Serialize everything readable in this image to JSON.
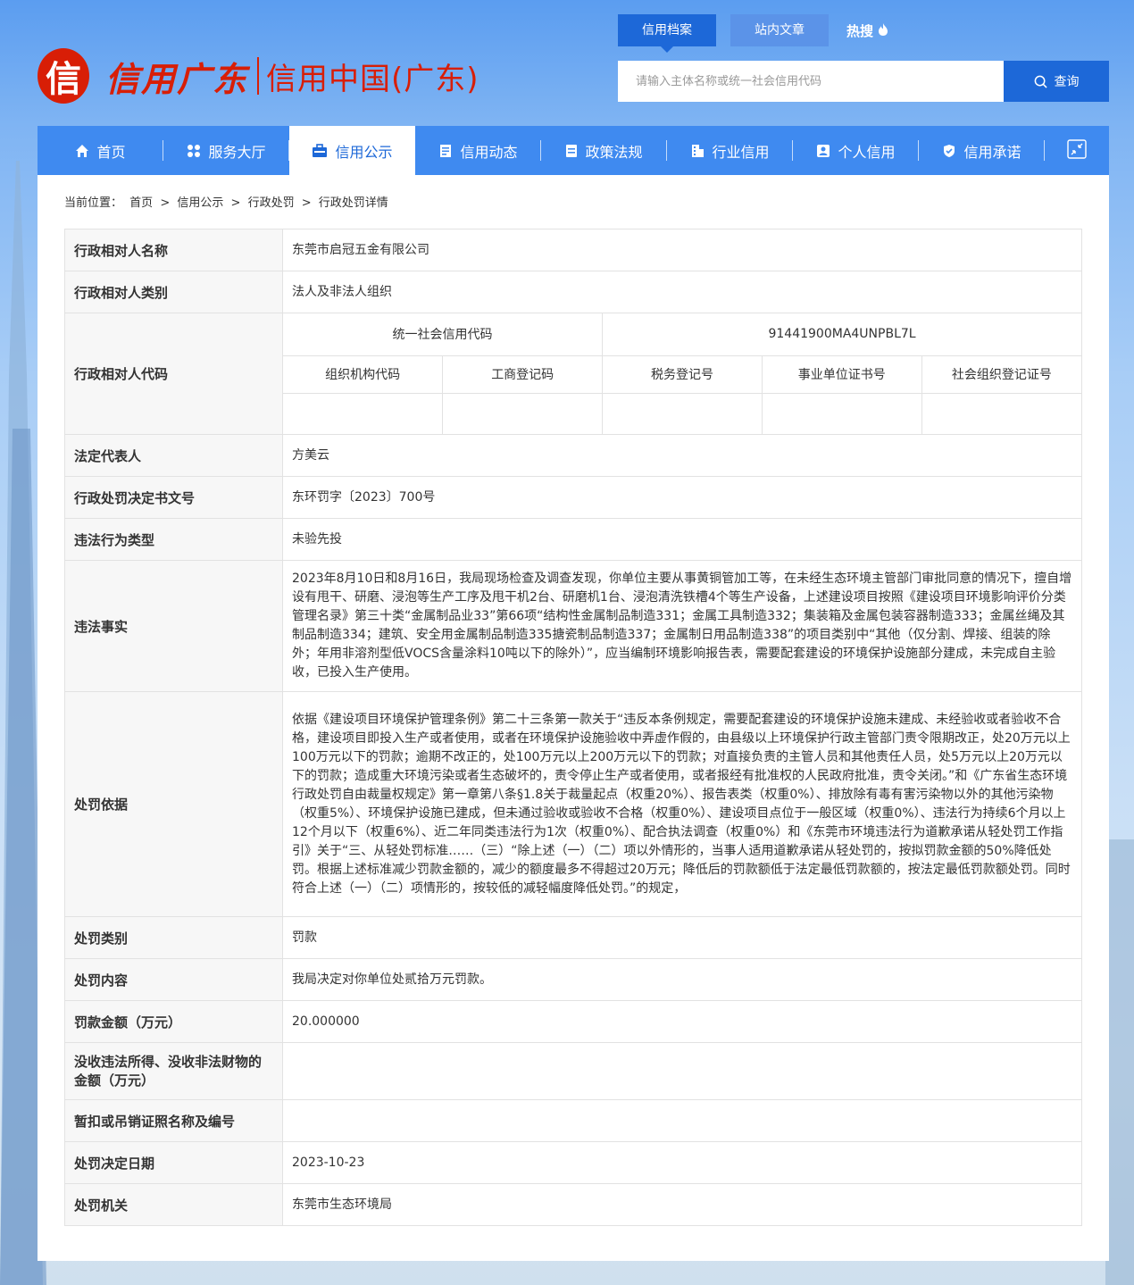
{
  "logo": {
    "mark": "信",
    "brand": "信用广东",
    "sub": "信用中国(广东)"
  },
  "search": {
    "tabs": [
      "信用档案",
      "站内文章"
    ],
    "hot": "热搜",
    "placeholder": "请输入主体名称或统一社会信用代码",
    "button": "查询"
  },
  "nav": {
    "items": [
      "首页",
      "服务大厅",
      "信用公示",
      "信用动态",
      "政策法规",
      "行业信用",
      "个人信用",
      "信用承诺"
    ]
  },
  "breadcrumb": {
    "prefix": "当前位置：",
    "items": [
      "首页",
      "信用公示",
      "行政处罚",
      "行政处罚详情"
    ],
    "sep": ">"
  },
  "detail": {
    "name_label": "行政相对人名称",
    "name": "东莞市启冠五金有限公司",
    "type_label": "行政相对人类别",
    "type": "法人及非法人组织",
    "code_label": "行政相对人代码",
    "credit_code_label": "统一社会信用代码",
    "credit_code": "91441900MA4UNPBL7L",
    "org_code_label": "组织机构代码",
    "biz_reg_label": "工商登记码",
    "tax_reg_label": "税务登记号",
    "inst_cert_label": "事业单位证书号",
    "social_org_label": "社会组织登记证号",
    "org_code": "",
    "biz_reg": "",
    "tax_reg": "",
    "inst_cert": "",
    "social_org": "",
    "legal_rep_label": "法定代表人",
    "legal_rep": "方美云",
    "doc_no_label": "行政处罚决定书文号",
    "doc_no": "东环罚字〔2023〕700号",
    "violation_type_label": "违法行为类型",
    "violation_type": "未验先投",
    "facts_label": "违法事实",
    "facts": "2023年8月10日和8月16日，我局现场检查及调查发现，你单位主要从事黄铜管加工等，在未经生态环境主管部门审批同意的情况下，擅自增设有甩干、研磨、浸泡等生产工序及甩干机2台、研磨机1台、浸泡清洗铁槽4个等生产设备，上述建设项目按照《建设项目环境影响评价分类管理名录》第三十类“金属制品业33”第66项“结构性金属制品制造331；金属工具制造332；集装箱及金属包装容器制造333；金属丝绳及其制品制造334；建筑、安全用金属制品制造335搪瓷制品制造337；金属制日用品制造338”的项目类别中“其他（仅分割、焊接、组装的除外；年用非溶剂型低VOCS含量涂料10吨以下的除外）”，应当编制环境影响报告表，需要配套建设的环境保护设施部分建成，未完成自主验收，已投入生产使用。",
    "basis_label": "处罚依据",
    "basis": "依据《建设项目环境保护管理条例》第二十三条第一款关于“违反本条例规定，需要配套建设的环境保护设施未建成、未经验收或者验收不合格，建设项目即投入生产或者使用，或者在环境保护设施验收中弄虚作假的，由县级以上环境保护行政主管部门责令限期改正，处20万元以上100万元以下的罚款；逾期不改正的，处100万元以上200万元以下的罚款；对直接负责的主管人员和其他责任人员，处5万元以上20万元以下的罚款；造成重大环境污染或者生态破坏的，责令停止生产或者使用，或者报经有批准权的人民政府批准，责令关闭。”和《广东省生态环境行政处罚自由裁量权规定》第一章第八条§1.8关于裁量起点（权重20%）、报告表类（权重0%）、排放除有毒有害污染物以外的其他污染物（权重5%）、环境保护设施已建成，但未通过验收或验收不合格（权重0%）、建设项目点位于一般区域（权重0%）、违法行为持续6个月以上12个月以下（权重6%）、近二年同类违法行为1次（权重0%）、配合执法调查（权重0%）和《东莞市环境违法行为道歉承诺从轻处罚工作指引》关于“三、从轻处罚标准……（三）“除上述（一）（二）项以外情形的，当事人适用道歉承诺从轻处罚的，按拟罚款金额的50%降低处罚。根据上述标准减少罚款金额的，减少的额度最多不得超过20万元；降低后的罚款额低于法定最低罚款额的，按法定最低罚款额处罚。同时符合上述（一）（二）项情形的，按较低的减轻幅度降低处罚。”的规定，",
    "category_label": "处罚类别",
    "category": "罚款",
    "content_label": "处罚内容",
    "content": "我局决定对你单位处贰拾万元罚款。",
    "fine_label": "罚款金额（万元）",
    "fine": "20.000000",
    "confiscation_label": "没收违法所得、没收非法财物的金额（万元）",
    "confiscation": "",
    "license_label": "暂扣或吊销证照名称及编号",
    "license": "",
    "date_label": "处罚决定日期",
    "date": "2023-10-23",
    "authority_label": "处罚机关",
    "authority": "东莞市生态环境局"
  },
  "colors": {
    "primary": "#1d68d8",
    "nav": "#3f8af0",
    "brand_red": "#d81e06"
  }
}
